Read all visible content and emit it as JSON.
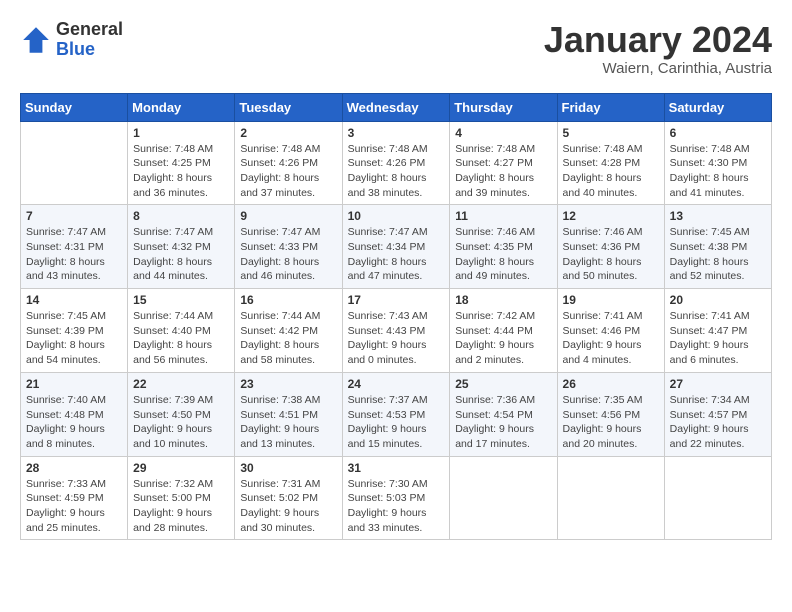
{
  "header": {
    "logo": {
      "general": "General",
      "blue": "Blue"
    },
    "title": "January 2024",
    "subtitle": "Waiern, Carinthia, Austria"
  },
  "weekdays": [
    "Sunday",
    "Monday",
    "Tuesday",
    "Wednesday",
    "Thursday",
    "Friday",
    "Saturday"
  ],
  "weeks": [
    [
      {
        "day": "",
        "sunrise": "",
        "sunset": "",
        "daylight": ""
      },
      {
        "day": "1",
        "sunrise": "Sunrise: 7:48 AM",
        "sunset": "Sunset: 4:25 PM",
        "daylight": "Daylight: 8 hours and 36 minutes."
      },
      {
        "day": "2",
        "sunrise": "Sunrise: 7:48 AM",
        "sunset": "Sunset: 4:26 PM",
        "daylight": "Daylight: 8 hours and 37 minutes."
      },
      {
        "day": "3",
        "sunrise": "Sunrise: 7:48 AM",
        "sunset": "Sunset: 4:26 PM",
        "daylight": "Daylight: 8 hours and 38 minutes."
      },
      {
        "day": "4",
        "sunrise": "Sunrise: 7:48 AM",
        "sunset": "Sunset: 4:27 PM",
        "daylight": "Daylight: 8 hours and 39 minutes."
      },
      {
        "day": "5",
        "sunrise": "Sunrise: 7:48 AM",
        "sunset": "Sunset: 4:28 PM",
        "daylight": "Daylight: 8 hours and 40 minutes."
      },
      {
        "day": "6",
        "sunrise": "Sunrise: 7:48 AM",
        "sunset": "Sunset: 4:30 PM",
        "daylight": "Daylight: 8 hours and 41 minutes."
      }
    ],
    [
      {
        "day": "7",
        "sunrise": "Sunrise: 7:47 AM",
        "sunset": "Sunset: 4:31 PM",
        "daylight": "Daylight: 8 hours and 43 minutes."
      },
      {
        "day": "8",
        "sunrise": "Sunrise: 7:47 AM",
        "sunset": "Sunset: 4:32 PM",
        "daylight": "Daylight: 8 hours and 44 minutes."
      },
      {
        "day": "9",
        "sunrise": "Sunrise: 7:47 AM",
        "sunset": "Sunset: 4:33 PM",
        "daylight": "Daylight: 8 hours and 46 minutes."
      },
      {
        "day": "10",
        "sunrise": "Sunrise: 7:47 AM",
        "sunset": "Sunset: 4:34 PM",
        "daylight": "Daylight: 8 hours and 47 minutes."
      },
      {
        "day": "11",
        "sunrise": "Sunrise: 7:46 AM",
        "sunset": "Sunset: 4:35 PM",
        "daylight": "Daylight: 8 hours and 49 minutes."
      },
      {
        "day": "12",
        "sunrise": "Sunrise: 7:46 AM",
        "sunset": "Sunset: 4:36 PM",
        "daylight": "Daylight: 8 hours and 50 minutes."
      },
      {
        "day": "13",
        "sunrise": "Sunrise: 7:45 AM",
        "sunset": "Sunset: 4:38 PM",
        "daylight": "Daylight: 8 hours and 52 minutes."
      }
    ],
    [
      {
        "day": "14",
        "sunrise": "Sunrise: 7:45 AM",
        "sunset": "Sunset: 4:39 PM",
        "daylight": "Daylight: 8 hours and 54 minutes."
      },
      {
        "day": "15",
        "sunrise": "Sunrise: 7:44 AM",
        "sunset": "Sunset: 4:40 PM",
        "daylight": "Daylight: 8 hours and 56 minutes."
      },
      {
        "day": "16",
        "sunrise": "Sunrise: 7:44 AM",
        "sunset": "Sunset: 4:42 PM",
        "daylight": "Daylight: 8 hours and 58 minutes."
      },
      {
        "day": "17",
        "sunrise": "Sunrise: 7:43 AM",
        "sunset": "Sunset: 4:43 PM",
        "daylight": "Daylight: 9 hours and 0 minutes."
      },
      {
        "day": "18",
        "sunrise": "Sunrise: 7:42 AM",
        "sunset": "Sunset: 4:44 PM",
        "daylight": "Daylight: 9 hours and 2 minutes."
      },
      {
        "day": "19",
        "sunrise": "Sunrise: 7:41 AM",
        "sunset": "Sunset: 4:46 PM",
        "daylight": "Daylight: 9 hours and 4 minutes."
      },
      {
        "day": "20",
        "sunrise": "Sunrise: 7:41 AM",
        "sunset": "Sunset: 4:47 PM",
        "daylight": "Daylight: 9 hours and 6 minutes."
      }
    ],
    [
      {
        "day": "21",
        "sunrise": "Sunrise: 7:40 AM",
        "sunset": "Sunset: 4:48 PM",
        "daylight": "Daylight: 9 hours and 8 minutes."
      },
      {
        "day": "22",
        "sunrise": "Sunrise: 7:39 AM",
        "sunset": "Sunset: 4:50 PM",
        "daylight": "Daylight: 9 hours and 10 minutes."
      },
      {
        "day": "23",
        "sunrise": "Sunrise: 7:38 AM",
        "sunset": "Sunset: 4:51 PM",
        "daylight": "Daylight: 9 hours and 13 minutes."
      },
      {
        "day": "24",
        "sunrise": "Sunrise: 7:37 AM",
        "sunset": "Sunset: 4:53 PM",
        "daylight": "Daylight: 9 hours and 15 minutes."
      },
      {
        "day": "25",
        "sunrise": "Sunrise: 7:36 AM",
        "sunset": "Sunset: 4:54 PM",
        "daylight": "Daylight: 9 hours and 17 minutes."
      },
      {
        "day": "26",
        "sunrise": "Sunrise: 7:35 AM",
        "sunset": "Sunset: 4:56 PM",
        "daylight": "Daylight: 9 hours and 20 minutes."
      },
      {
        "day": "27",
        "sunrise": "Sunrise: 7:34 AM",
        "sunset": "Sunset: 4:57 PM",
        "daylight": "Daylight: 9 hours and 22 minutes."
      }
    ],
    [
      {
        "day": "28",
        "sunrise": "Sunrise: 7:33 AM",
        "sunset": "Sunset: 4:59 PM",
        "daylight": "Daylight: 9 hours and 25 minutes."
      },
      {
        "day": "29",
        "sunrise": "Sunrise: 7:32 AM",
        "sunset": "Sunset: 5:00 PM",
        "daylight": "Daylight: 9 hours and 28 minutes."
      },
      {
        "day": "30",
        "sunrise": "Sunrise: 7:31 AM",
        "sunset": "Sunset: 5:02 PM",
        "daylight": "Daylight: 9 hours and 30 minutes."
      },
      {
        "day": "31",
        "sunrise": "Sunrise: 7:30 AM",
        "sunset": "Sunset: 5:03 PM",
        "daylight": "Daylight: 9 hours and 33 minutes."
      },
      {
        "day": "",
        "sunrise": "",
        "sunset": "",
        "daylight": ""
      },
      {
        "day": "",
        "sunrise": "",
        "sunset": "",
        "daylight": ""
      },
      {
        "day": "",
        "sunrise": "",
        "sunset": "",
        "daylight": ""
      }
    ]
  ]
}
